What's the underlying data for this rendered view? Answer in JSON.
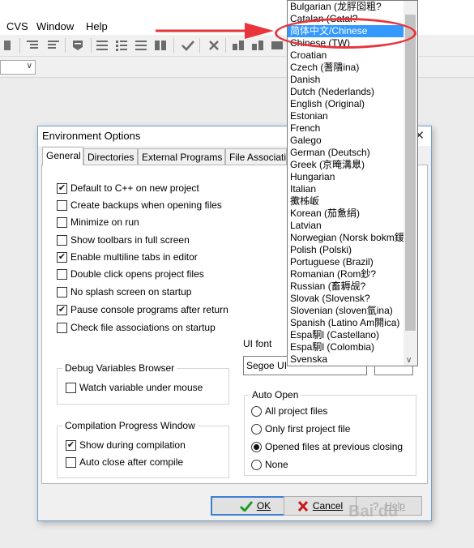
{
  "menubar": {
    "items": [
      "CVS",
      "Window",
      "Help"
    ]
  },
  "dialog": {
    "title": "Environment Options",
    "tabs": [
      "General",
      "Directories",
      "External Programs",
      "File Associatio"
    ],
    "options": [
      {
        "label": "Default to C++ on new project",
        "checked": true
      },
      {
        "label": "Create backups when opening files",
        "checked": false
      },
      {
        "label": "Minimize on run",
        "checked": false
      },
      {
        "label": "Show toolbars in full screen",
        "checked": false
      },
      {
        "label": "Enable multiline tabs in editor",
        "checked": true
      },
      {
        "label": "Double click opens project files",
        "checked": false
      },
      {
        "label": "No splash screen on startup",
        "checked": false
      },
      {
        "label": "Pause console programs after return",
        "checked": true
      },
      {
        "label": "Check file associations on startup",
        "checked": false
      }
    ],
    "debug_group": {
      "caption": "Debug Variables Browser",
      "watch": {
        "label": "Watch variable under mouse",
        "checked": false
      }
    },
    "compile_group": {
      "caption": "Compilation Progress Window",
      "show": {
        "label": "Show during compilation",
        "checked": true
      },
      "autoclose": {
        "label": "Auto close after compile",
        "checked": false
      }
    },
    "ui_font": {
      "label": "UI font",
      "value": "Segoe UI"
    },
    "auto_open": {
      "caption": "Auto Open",
      "options": [
        {
          "label": "All project files",
          "selected": false
        },
        {
          "label": "Only first project file",
          "selected": false
        },
        {
          "label": "Opened files at previous closing",
          "selected": true
        },
        {
          "label": "None",
          "selected": false
        }
      ]
    },
    "buttons": {
      "ok": "OK",
      "cancel": "Cancel",
      "help": "Help"
    }
  },
  "language_list": {
    "items": [
      "Bulgarian (龙脬囵粗?",
      "Catalan (Catal?",
      "简体中文/Chinese",
      "Chinese (TW)",
      "Croatian",
      "Czech (蓍隤ina)",
      "Danish",
      "Dutch (Nederlands)",
      "English (Original)",
      "Estonian",
      "French",
      "Galego",
      "German (Deutsch)",
      "Greek (京晻溝臮)",
      "Hungarian",
      "Italian",
      "擹柹岅",
      "Korean (茄惫绢)",
      "Latvian",
      "Norwegian (Norsk bokm鍰",
      "Polish (Polski)",
      "Portuguese (Brazil)",
      "Romanian (Rom鈔?",
      "Russian (畜耨觇?",
      "Slovak (Slovensk?",
      "Slovenian (sloven氩ina)",
      "Spanish (Latino Am閞ica)",
      "Espa駉l (Castellano)",
      "Espa駉l (Colombia)",
      "Svenska"
    ],
    "selected_index": 2
  },
  "colors": {
    "selection": "#3399ff",
    "annotation": "#e8343a",
    "dialog_border": "#6d9fcf"
  }
}
